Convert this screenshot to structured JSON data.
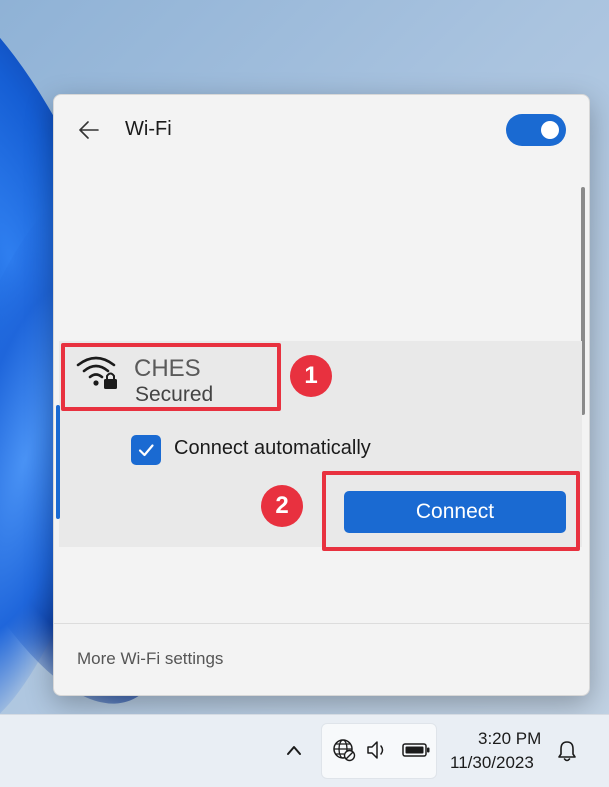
{
  "panel": {
    "title": "Wi-Fi",
    "wifi_enabled": true,
    "more_settings_label": "More Wi-Fi settings"
  },
  "network": {
    "name": "CHES",
    "status": "Secured",
    "connect_automatically_label": "Connect automatically",
    "connect_automatically_checked": true,
    "connect_button_label": "Connect"
  },
  "annotations": {
    "step_1": "1",
    "step_2": "2"
  },
  "taskbar": {
    "time": "3:20 PM",
    "date": "11/30/2023"
  },
  "colors": {
    "accent": "#1a6ad2",
    "highlight": "#e8313f"
  }
}
